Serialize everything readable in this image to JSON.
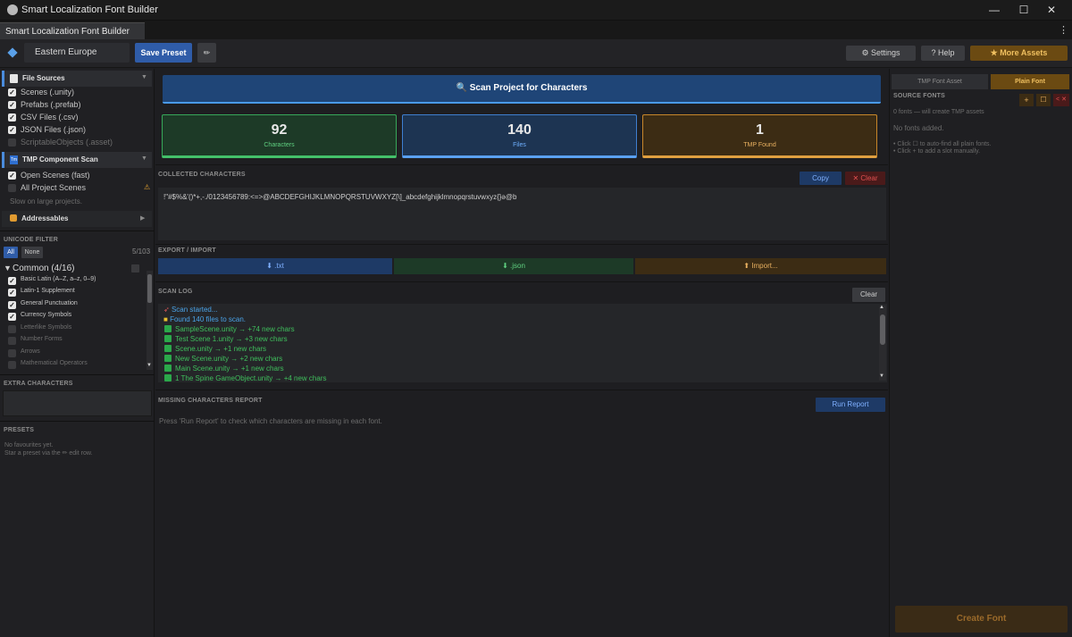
{
  "window": {
    "title": "Smart Localization Font Builder",
    "minimize_glyph": "—",
    "maximize_glyph": "☐",
    "close_glyph": "✕"
  },
  "tab": {
    "label": "Smart Localization Font Builder",
    "menu_glyph": "⋮"
  },
  "toolbar": {
    "preset_name": "Eastern Europe",
    "save_preset": "Save Preset",
    "edit_glyph": "✏",
    "settings": "Settings",
    "help": "? Help",
    "more_assets": "More Assets"
  },
  "left": {
    "file_sources": {
      "title": "File Sources",
      "items": [
        {
          "label": "Scenes (.unity)",
          "checked": true
        },
        {
          "label": "Prefabs (.prefab)",
          "checked": true
        },
        {
          "label": "CSV Files (.csv)",
          "checked": true
        },
        {
          "label": "JSON Files (.json)",
          "checked": true
        },
        {
          "label": "ScriptableObjects (.asset)",
          "checked": false
        }
      ]
    },
    "tmp_scan": {
      "title": "TMP Component Scan",
      "icon_text": "Tm",
      "open_scenes": "Open Scenes (fast)",
      "all_scenes": "All Project Scenes",
      "warning": "Slow on large projects."
    },
    "addressables": {
      "title": "Addressables"
    },
    "unicode": {
      "title": "UNICODE FILTER",
      "all": "All",
      "none": "None",
      "count": "5/103",
      "group": "Common (4/16)",
      "items": [
        {
          "label": "Basic Latin (A–Z, a–z, 0–9)",
          "checked": true
        },
        {
          "label": "Latin-1 Supplement",
          "checked": true
        },
        {
          "label": "General Punctuation",
          "checked": true
        },
        {
          "label": "Currency Symbols",
          "checked": true
        },
        {
          "label": "Letterlike Symbols",
          "checked": false
        },
        {
          "label": "Number Forms",
          "checked": false
        },
        {
          "label": "Arrows",
          "checked": false
        },
        {
          "label": "Mathematical Operators",
          "checked": false
        }
      ]
    },
    "extra": {
      "title": "EXTRA CHARACTERS"
    },
    "presets": {
      "title": "PRESETS",
      "line1": "No favourites yet.",
      "line2": "Star a preset via the ✏ edit row."
    }
  },
  "center": {
    "scan_button": "Scan Project for Characters",
    "stats": [
      {
        "value": "92",
        "label": "Characters"
      },
      {
        "value": "140",
        "label": "Files"
      },
      {
        "value": "1",
        "label": "TMP Found"
      }
    ],
    "collected": {
      "title": "COLLECTED CHARACTERS",
      "copy": "Copy",
      "clear": "✕ Clear",
      "text": "!\"#$%&'()*+,-./0123456789:<=>@ABCDEFGHIJKLMNOPQRSTUVWXYZ[\\]_abcdefghijklmnopqrstuvwxyz{}ə@b"
    },
    "export": {
      "title": "EXPORT  /  IMPORT",
      "txt": "⬇ .txt",
      "json": "⬇ .json",
      "import": "⬆ Import..."
    },
    "scan_log": {
      "title": "SCAN LOG",
      "clear": "Clear",
      "lines": [
        {
          "icon": "🚀",
          "text": "Scan started...",
          "color": "#4aa3e8"
        },
        {
          "icon": "📁",
          "text": "Found 140 files to scan.",
          "color": "#4aa3e8"
        },
        {
          "icon": "✅",
          "text": "SampleScene.unity → +74 new chars",
          "color": "#3fbf5c"
        },
        {
          "icon": "✅",
          "text": "Test Scene 1.unity → +3 new chars",
          "color": "#3fbf5c"
        },
        {
          "icon": "✅",
          "text": "Scene.unity → +1 new chars",
          "color": "#3fbf5c"
        },
        {
          "icon": "✅",
          "text": "New Scene.unity → +2 new chars",
          "color": "#3fbf5c"
        },
        {
          "icon": "✅",
          "text": "Main Scene.unity → +1 new chars",
          "color": "#3fbf5c"
        },
        {
          "icon": "✅",
          "text": "1 The Spine GameObject.unity → +4 new chars",
          "color": "#3fbf5c"
        }
      ]
    },
    "missing": {
      "title": "MISSING CHARACTERS REPORT",
      "run": "Run Report",
      "hint": "Press 'Run Report' to check which characters are missing in each font."
    }
  },
  "right": {
    "tabs": [
      "TMP Font Asset",
      "Plain Font"
    ],
    "source_title": "SOURCE FONTS",
    "add": "+",
    "auto": "☐",
    "remove": "< ✕",
    "info": "0 fonts — will create TMP assets",
    "empty": "No fonts added.",
    "hint1": "• Click  ☐  to auto-find all plain fonts.",
    "hint2": "• Click  +  to add a slot manually.",
    "create": "Create Font"
  },
  "colors": {
    "accent_blue": "#2f5ca8",
    "green": "#2f8a45",
    "blue": "#3f7fd0",
    "orange": "#c8872a"
  }
}
